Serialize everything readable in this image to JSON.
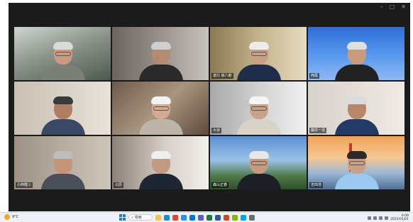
{
  "window": {
    "controls": [
      "–",
      "□",
      "✕"
    ]
  },
  "participants": [
    {
      "name": "",
      "active": true
    },
    {
      "name": ""
    },
    {
      "name": "渡辺 鉄八郎"
    },
    {
      "name": "西尾"
    },
    {
      "name": ""
    },
    {
      "name": ""
    },
    {
      "name": "大谷"
    },
    {
      "name": "藤井一清"
    },
    {
      "name": "小西隆三"
    },
    {
      "name": "北原"
    },
    {
      "name": "森山正春"
    },
    {
      "name": "吉田浩"
    }
  ],
  "taskbar": {
    "weather_temp": "9°C",
    "search_placeholder": "検索",
    "time": "0:00",
    "date": "2025/01/01"
  },
  "colors": {
    "active_speaker": "#39c55a",
    "window_bg": "#1b1b1b",
    "taskbar_bg": "#eef1f6"
  }
}
